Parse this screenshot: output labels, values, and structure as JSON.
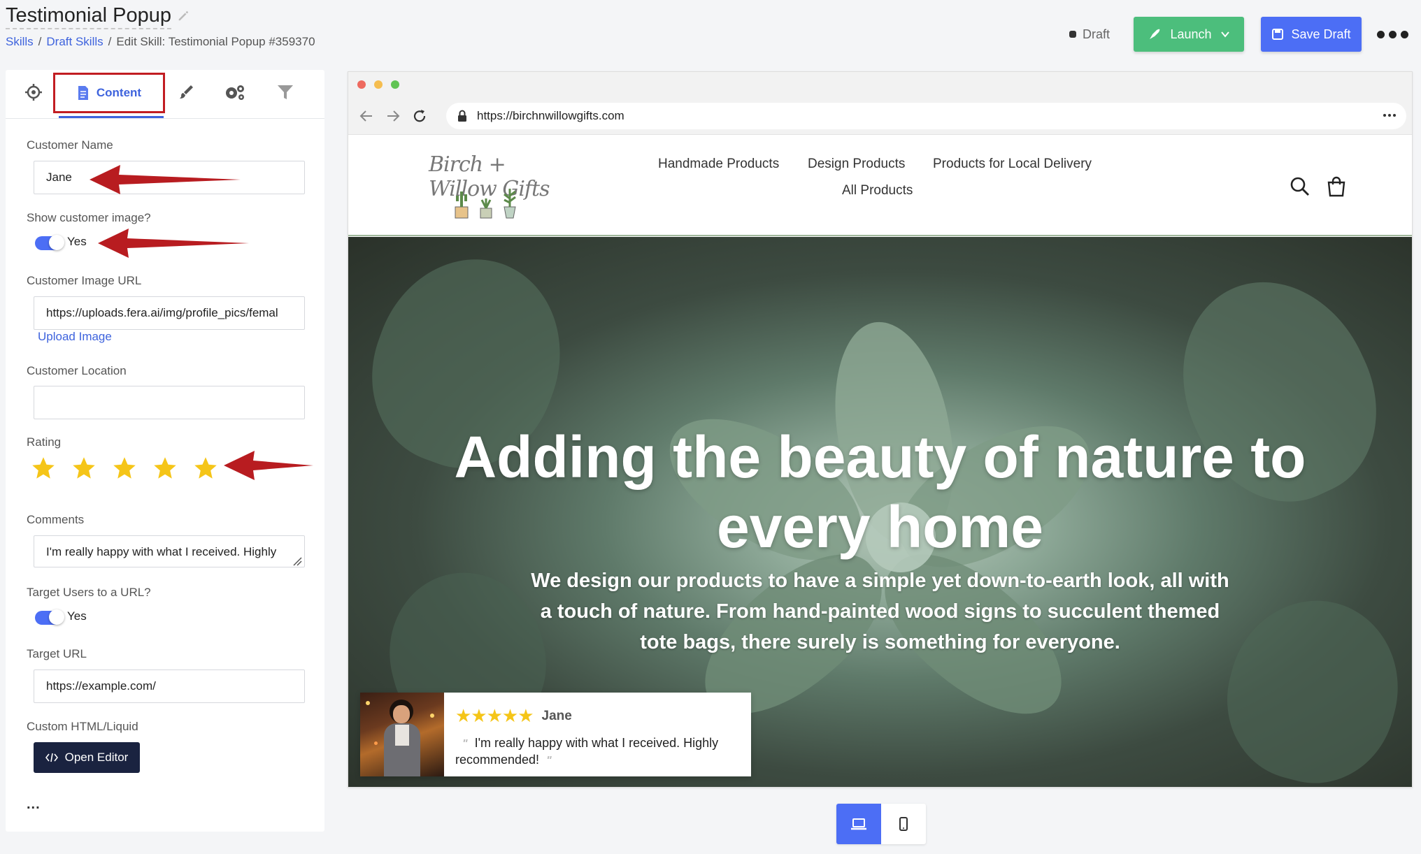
{
  "header": {
    "title": "Testimonial Popup",
    "breadcrumb": {
      "skills": "Skills",
      "sep": "/",
      "draft_skills": "Draft Skills",
      "current": "Edit Skill: Testimonial Popup #359370"
    },
    "status": "Draft",
    "launch_label": "Launch",
    "save_label": "Save Draft"
  },
  "tabs": {
    "content_label": "Content"
  },
  "form": {
    "customer_name": {
      "label": "Customer Name",
      "value": "Jane"
    },
    "show_image": {
      "label": "Show customer image?",
      "toggle": "Yes"
    },
    "image_url": {
      "label": "Customer Image URL",
      "value": "https://uploads.fera.ai/img/profile_pics/femal",
      "upload": "Upload Image"
    },
    "location": {
      "label": "Customer Location",
      "value": ""
    },
    "rating": {
      "label": "Rating",
      "value": 5,
      "max": 5
    },
    "comments": {
      "label": "Comments",
      "value": "I'm really happy with what I received. Highly"
    },
    "target_users": {
      "label": "Target Users to a URL?",
      "toggle": "Yes"
    },
    "target_url": {
      "label": "Target URL",
      "value": "https://example.com/"
    },
    "custom_html": {
      "label": "Custom HTML/Liquid",
      "button": "Open Editor"
    },
    "more": "..."
  },
  "browser": {
    "url": "https://birchnwillowgifts.com",
    "logo_text": "Birch + Willow Gifts",
    "nav": {
      "handmade": "Handmade Products",
      "design": "Design Products",
      "local": "Products for Local Delivery",
      "all": "All Products"
    },
    "hero_title": "Adding the beauty of nature to every home",
    "hero_subtitle": "We design our products to have a simple yet down-to-earth look, all with a touch of nature. From hand-painted wood signs to succulent themed tote bags, there surely is something for everyone."
  },
  "testimonial": {
    "stars": "★★★★★",
    "name": "Jane",
    "comment": "I'm really happy with what I received. Highly recommended!"
  },
  "colors": {
    "accent": "#3e63dd",
    "launch": "#4cbe7c",
    "save": "#4c6ef5",
    "highlight_border": "#c21d22",
    "star": "#f5c518"
  }
}
